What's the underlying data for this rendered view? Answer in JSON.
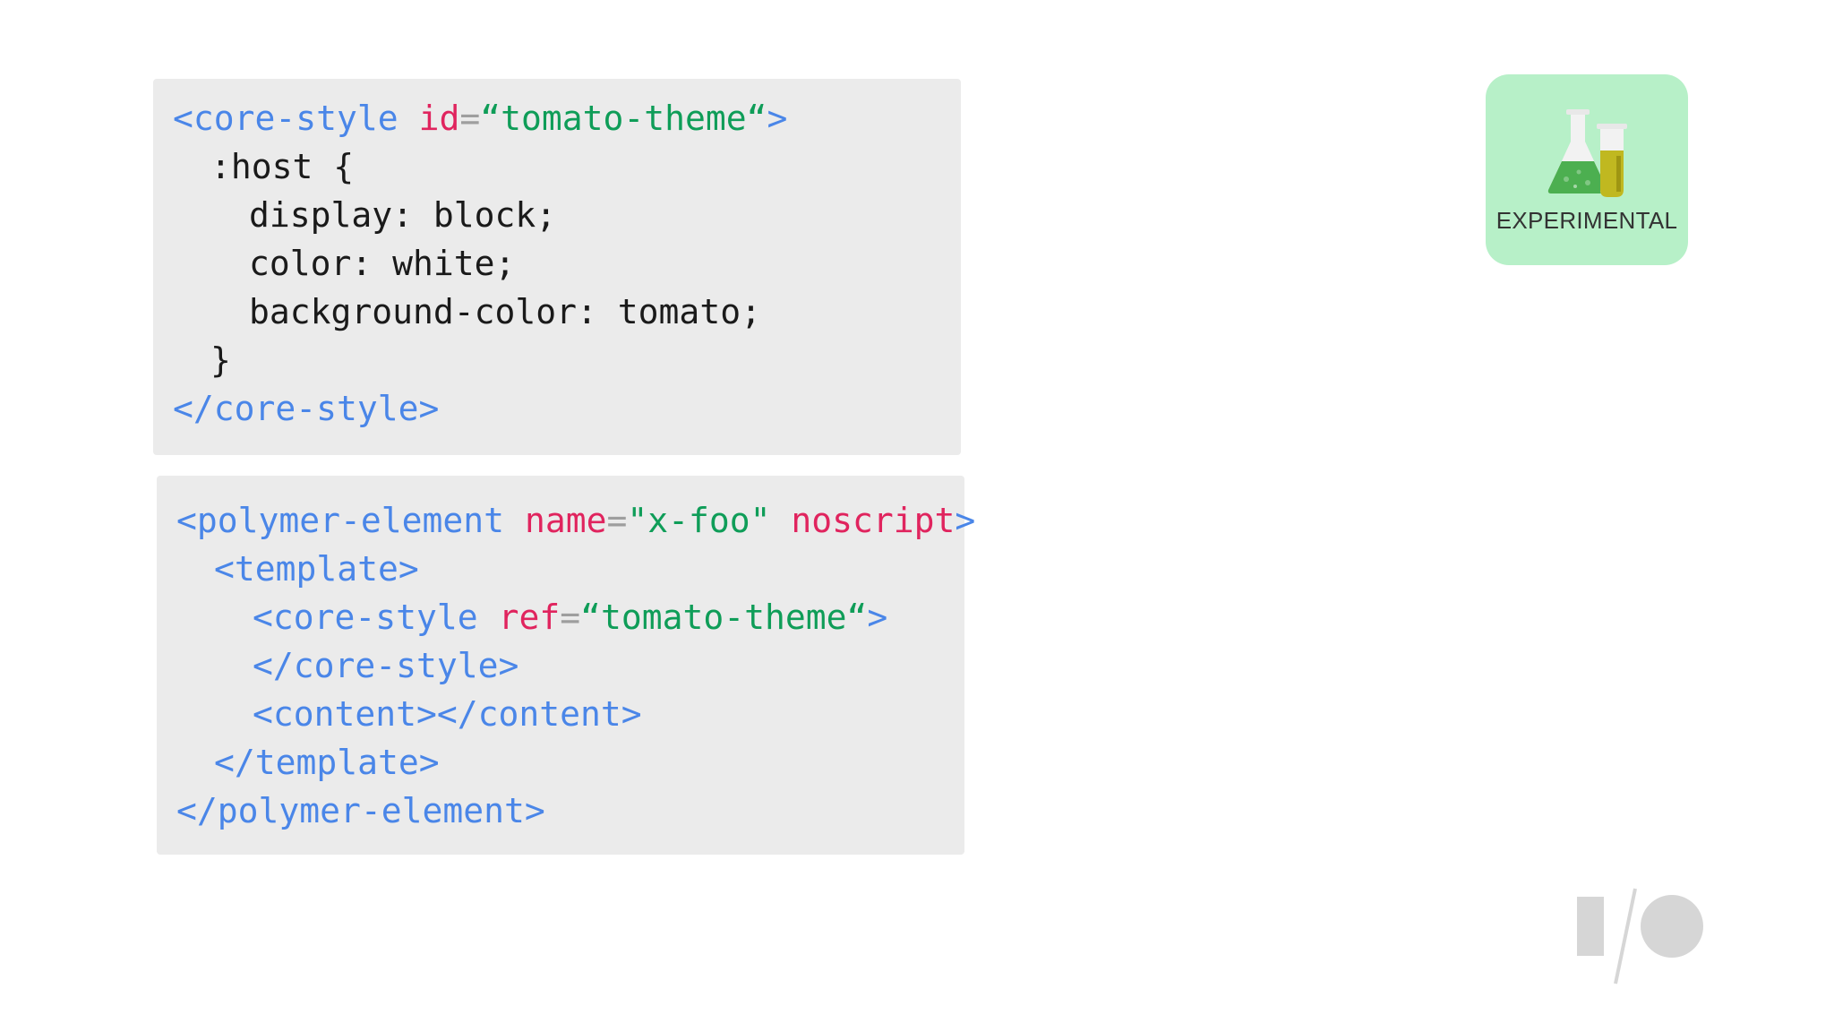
{
  "code_block_1": {
    "lines": [
      {
        "tag_open": "<core-style",
        "attr": "id",
        "eq": "=",
        "value": "“tomato-theme“",
        "tag_close": ">"
      },
      {
        "text": ":host {"
      },
      {
        "text": "display: block;"
      },
      {
        "text": "color: white;"
      },
      {
        "text": "background-color: tomato;"
      },
      {
        "text": "}"
      },
      {
        "tag": "</core-style>"
      }
    ]
  },
  "code_block_2": {
    "lines": [
      {
        "tag_open": "<polymer-element",
        "attr": "name",
        "eq": "=",
        "value": "\"x-foo\"",
        "attr2": "noscript",
        "tag_close": ">"
      },
      {
        "tag": "<template>"
      },
      {
        "tag_open": "<core-style",
        "attr": "ref",
        "eq": "=",
        "value": "“tomato-theme“",
        "tag_close": ">"
      },
      {
        "tag": "</core-style>"
      },
      {
        "tag": "<content></content>"
      },
      {
        "tag": "</template>"
      },
      {
        "tag": "</polymer-element>"
      }
    ]
  },
  "badge": {
    "label": "EXPERIMENTAL",
    "icon": "lab-flask-icon",
    "background": "#b7f0c8"
  },
  "logo": {
    "icon": "google-io-logo-icon"
  },
  "colors": {
    "tag": "#4a86e8",
    "attribute": "#e0245e",
    "string": "#0f9d58",
    "code_background": "#ebebeb"
  }
}
